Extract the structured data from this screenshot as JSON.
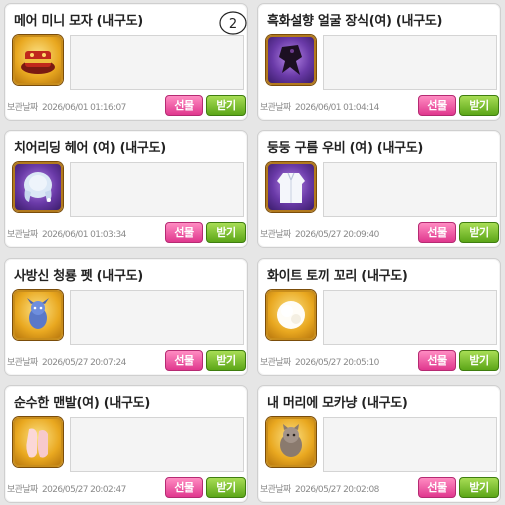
{
  "labels": {
    "date_label": "보관날짜",
    "gift_button": "선물",
    "receive_button": "받기"
  },
  "annotation": "2",
  "items": [
    {
      "name": "메어 미니 모자 (내구도)",
      "date": "2026/06/01 01:16:07",
      "icon": "red-hat-icon"
    },
    {
      "name": "흑화설향 얼굴 장식(여) (내구도)",
      "date": "2026/06/01 01:04:14",
      "icon": "dark-face-decoration-icon"
    },
    {
      "name": "치어리딩 헤어 (여) (내구도)",
      "date": "2026/06/01 01:03:34",
      "icon": "cheer-hair-icon"
    },
    {
      "name": "둥둥 구름 우비 (여) (내구도)",
      "date": "2026/05/27 20:09:40",
      "icon": "cloud-raincoat-icon"
    },
    {
      "name": "사방신 청룡 펫 (내구도)",
      "date": "2026/05/27 20:07:24",
      "icon": "blue-dragon-pet-icon"
    },
    {
      "name": "화이트 토끼 꼬리 (내구도)",
      "date": "2026/05/27 20:05:10",
      "icon": "white-rabbit-tail-icon"
    },
    {
      "name": "순수한 맨발(여) (내구도)",
      "date": "2026/05/27 20:02:47",
      "icon": "bare-feet-icon"
    },
    {
      "name": "내 머리에 모카냥 (내구도)",
      "date": "2026/05/27 20:02:08",
      "icon": "mocha-cat-head-icon"
    }
  ]
}
